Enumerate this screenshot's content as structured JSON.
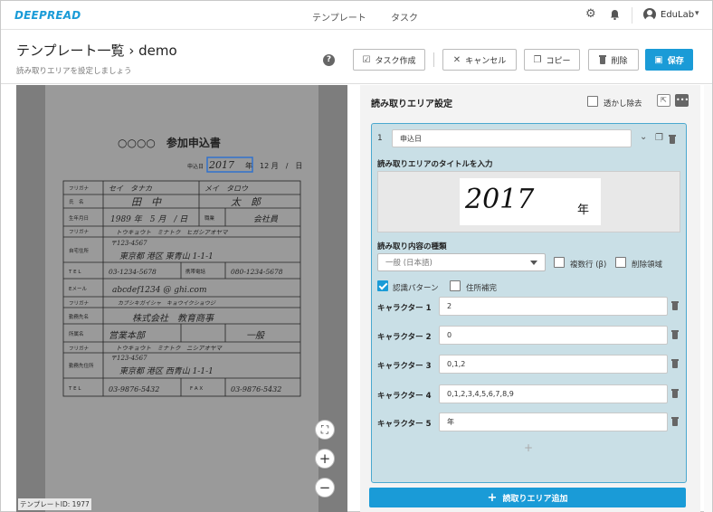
{
  "app": {
    "logo": "DEEPREAD"
  },
  "nav": {
    "templates": "テンプレート",
    "tasks": "タスク",
    "user": "EduLab"
  },
  "header": {
    "title": "テンプレート一覧 › demo",
    "subtitle": "読み取りエリアを設定しましょう",
    "help": "?",
    "buttons": {
      "create_task": "タスク作成",
      "cancel": "キャンセル",
      "copy": "コピー",
      "delete": "削除",
      "save": "保存"
    }
  },
  "document": {
    "template_id": "テンプレートID: 1977",
    "form_title": "○○○○　参加申込書",
    "date_label": "申込日",
    "date_year": "2017",
    "date_rest": "年　12 月　/　日",
    "rows": [
      [
        "フリガナ",
        "セイ　タナカ",
        "メイ　タロウ"
      ],
      [
        "氏　名",
        "田　中",
        "太　郎"
      ],
      [
        "生年月日",
        "1989 年　5 月　/ 日",
        "職業",
        "会社員"
      ],
      [
        "フリガナ",
        "トウキョウト　ミナトク　ヒガシアオヤマ"
      ],
      [
        "自宅住所",
        "〒123-4567",
        "東京都 港区 東青山 1-1-1"
      ],
      [
        "T E L",
        "03-1234-5678",
        "携帯電話",
        "080-1234-5678"
      ],
      [
        "Eメール",
        "abcdef1234 @ ghi.com"
      ],
      [
        "フリガナ",
        "カブシキガイシャ　キョウイクショウジ"
      ],
      [
        "勤務先名",
        "株式会社　教育商事"
      ],
      [
        "所属名",
        "営業本部",
        "一般"
      ],
      [
        "フリガナ",
        "トウキョウト　ミナトク　ニシアオヤマ"
      ],
      [
        "勤務先住所",
        "〒123-4567",
        "東京都 港区 西青山 1-1-1"
      ],
      [
        "T E L",
        "03-9876-5432",
        "F A X",
        "03-9876-5432"
      ]
    ]
  },
  "panel": {
    "title": "読み取りエリア設定",
    "watermark_label": "透かし除去",
    "area": {
      "number": "1",
      "name": "申込日",
      "title_prompt": "読み取りエリアのタイトルを入力",
      "preview_text": "2017",
      "preview_suffix": "年",
      "type_label": "読み取り内容の種類",
      "type_value": "一般 (日本語)",
      "multiline_label": "複数行 (β)",
      "delete_area_label": "削除領域",
      "pattern_label": "認識パターン",
      "address_label": "住所補完",
      "characters": [
        {
          "label": "キャラクター 1",
          "value": "2"
        },
        {
          "label": "キャラクター 2",
          "value": "0"
        },
        {
          "label": "キャラクター 3",
          "value": "0,1,2"
        },
        {
          "label": "キャラクター 4",
          "value": "0,1,2,3,4,5,6,7,8,9"
        },
        {
          "label": "キャラクター 5",
          "value": "年"
        }
      ]
    },
    "add_button": "読取りエリア追加"
  }
}
